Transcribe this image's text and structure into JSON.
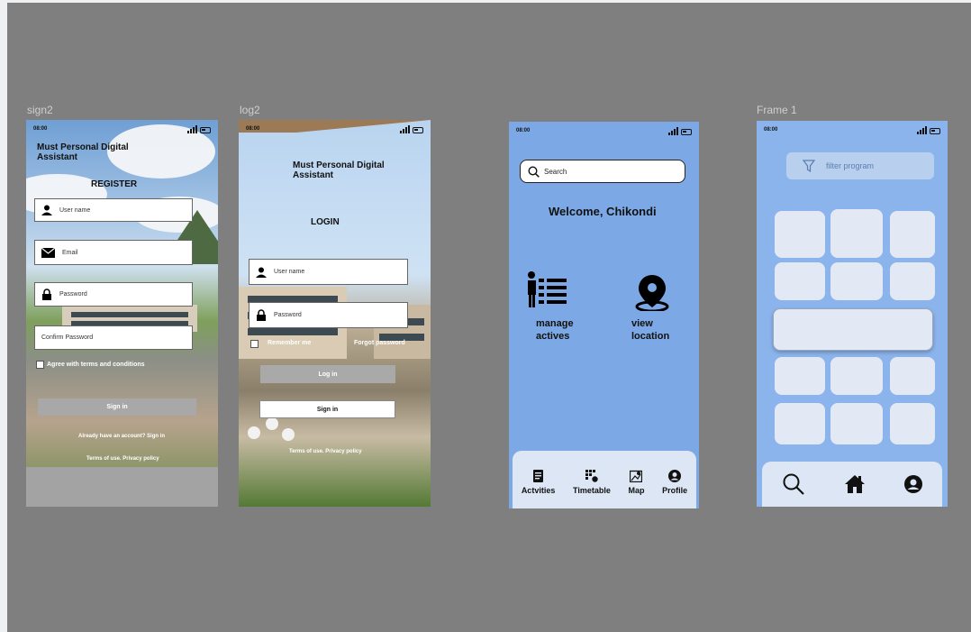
{
  "frames": {
    "sign2": {
      "label": "sign2",
      "status_time": "08:00",
      "app_title": "Must Personal Digital Assistant",
      "heading": "REGISTER",
      "fields": [
        "User name",
        "Email",
        "Password",
        "Confirm Password"
      ],
      "agree_text": "Agree with terms and conditions",
      "button": "Sign in",
      "account_text": "Already have an account? Sign in",
      "footer_text": "Terms of use. Privacy policy"
    },
    "log2": {
      "label": "log2",
      "status_time": "08:00",
      "app_title": "Must Personal Digital Assistant",
      "heading": "LOGIN",
      "fields": [
        "User name",
        "Password"
      ],
      "remember_text": "Remember me",
      "forgot_text": "Forgot password",
      "login_button": "Log in",
      "signin_button": "Sign in",
      "footer_text": "Terms of use. Privacy policy"
    },
    "home": {
      "status_time": "08:00",
      "search_placeholder": "Search",
      "welcome": "Welcome, Chikondi",
      "action_manage": "manage actives",
      "action_manage_1": "manage",
      "action_manage_2": "actives",
      "action_view_1": "view",
      "action_view_2": "location",
      "nav": [
        "Actvities",
        "Timetable",
        "Map",
        "Profile"
      ]
    },
    "frame1": {
      "label": "Frame 1",
      "status_time": "08:00",
      "filter_placeholder": "filter program"
    }
  },
  "colors": {
    "canvas": "#7f7f7f",
    "phone_blue": "#7ca9e6",
    "frame1_blue": "#8cb4ec",
    "nav_bg": "#dde6f4"
  }
}
